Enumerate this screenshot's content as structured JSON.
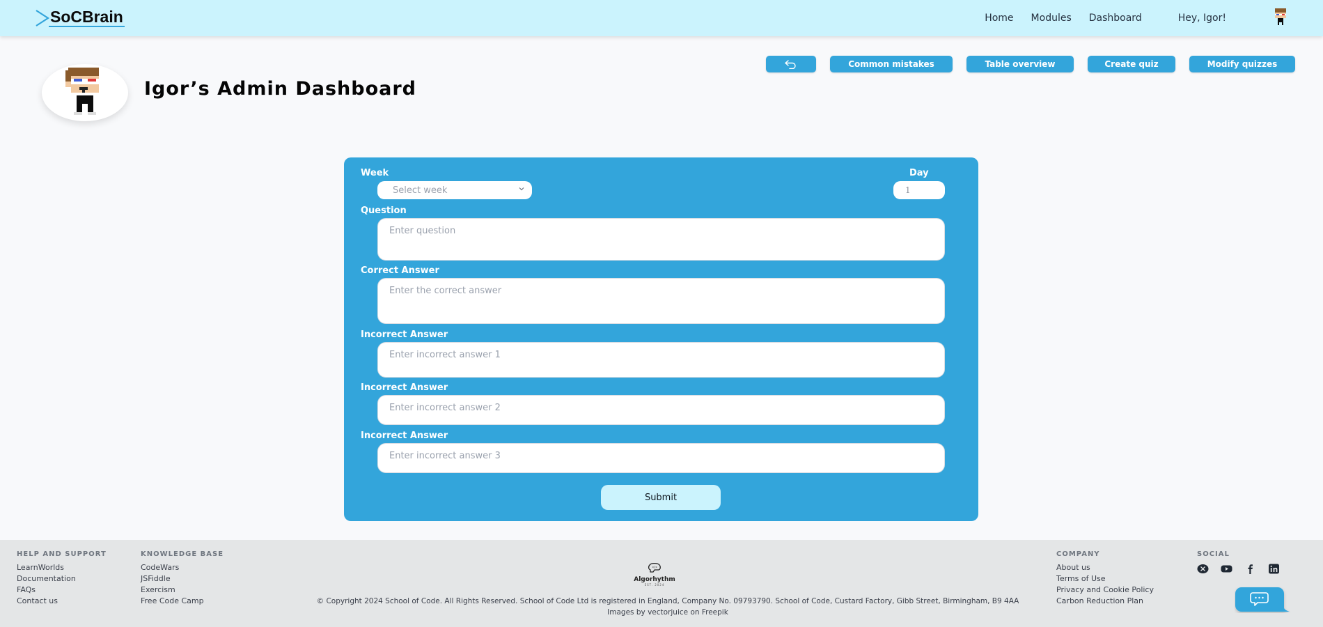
{
  "header": {
    "brand": "SoCBrain",
    "nav": [
      {
        "label": "Home"
      },
      {
        "label": "Modules"
      },
      {
        "label": "Dashboard"
      }
    ],
    "greeting": "Hey, Igor!",
    "avatar_icon": "pixel-avatar-icon"
  },
  "page": {
    "title": "Igor’s Admin Dashboard"
  },
  "actions": {
    "back_icon": "undo-arrow-icon",
    "buttons": [
      {
        "label": "Common mistakes"
      },
      {
        "label": "Table overview"
      },
      {
        "label": "Create quiz"
      },
      {
        "label": "Modify quizzes"
      }
    ]
  },
  "form": {
    "week_label": "Week",
    "week_select_value": "Select week",
    "day_label": "Day",
    "day_value": "1",
    "question_label": "Question",
    "question_placeholder": "Enter question",
    "correct_label": "Correct Answer",
    "correct_placeholder": "Enter the correct answer",
    "incorrect": [
      {
        "label": "Incorrect Answer",
        "placeholder": "Enter incorrect answer 1"
      },
      {
        "label": "Incorrect Answer",
        "placeholder": "Enter incorrect answer 2"
      },
      {
        "label": "Incorrect Answer",
        "placeholder": "Enter incorrect answer 3"
      }
    ],
    "submit_label": "Submit"
  },
  "footer": {
    "help": {
      "heading": "HELP AND SUPPORT",
      "links": [
        "LearnWorlds",
        "Documentation",
        "FAQs",
        "Contact us"
      ]
    },
    "knowledge": {
      "heading": "KNOWLEDGE BASE",
      "links": [
        "CodeWars",
        "JSFiddle",
        "Exercism",
        "Free Code Camp"
      ]
    },
    "company": {
      "heading": "COMPANY",
      "links": [
        "About us",
        "Terms of Use",
        "Privacy and Cookie Policy",
        "Carbon Reduction Plan"
      ]
    },
    "social": {
      "heading": "SOCIAL",
      "icons": [
        "x-icon",
        "youtube-icon",
        "facebook-icon",
        "linkedin-icon"
      ]
    },
    "brand_name": "Algorhythm",
    "brand_est": "EST. 2024",
    "copyright": "© Copyright 2024 School of Code. All Rights Reserved. School of Code Ltd is registered in England, Company No. 09793790. School of Code, Custard Factory, Gibb Street, Birmingham, B9 4AA",
    "credits": "Images by vectorjuice on Freepik"
  },
  "colors": {
    "accent": "#33a5db",
    "header_bg": "#cbf3fd",
    "footer_bg": "#e4e6e7",
    "page_bg": "#f8f9fb"
  }
}
